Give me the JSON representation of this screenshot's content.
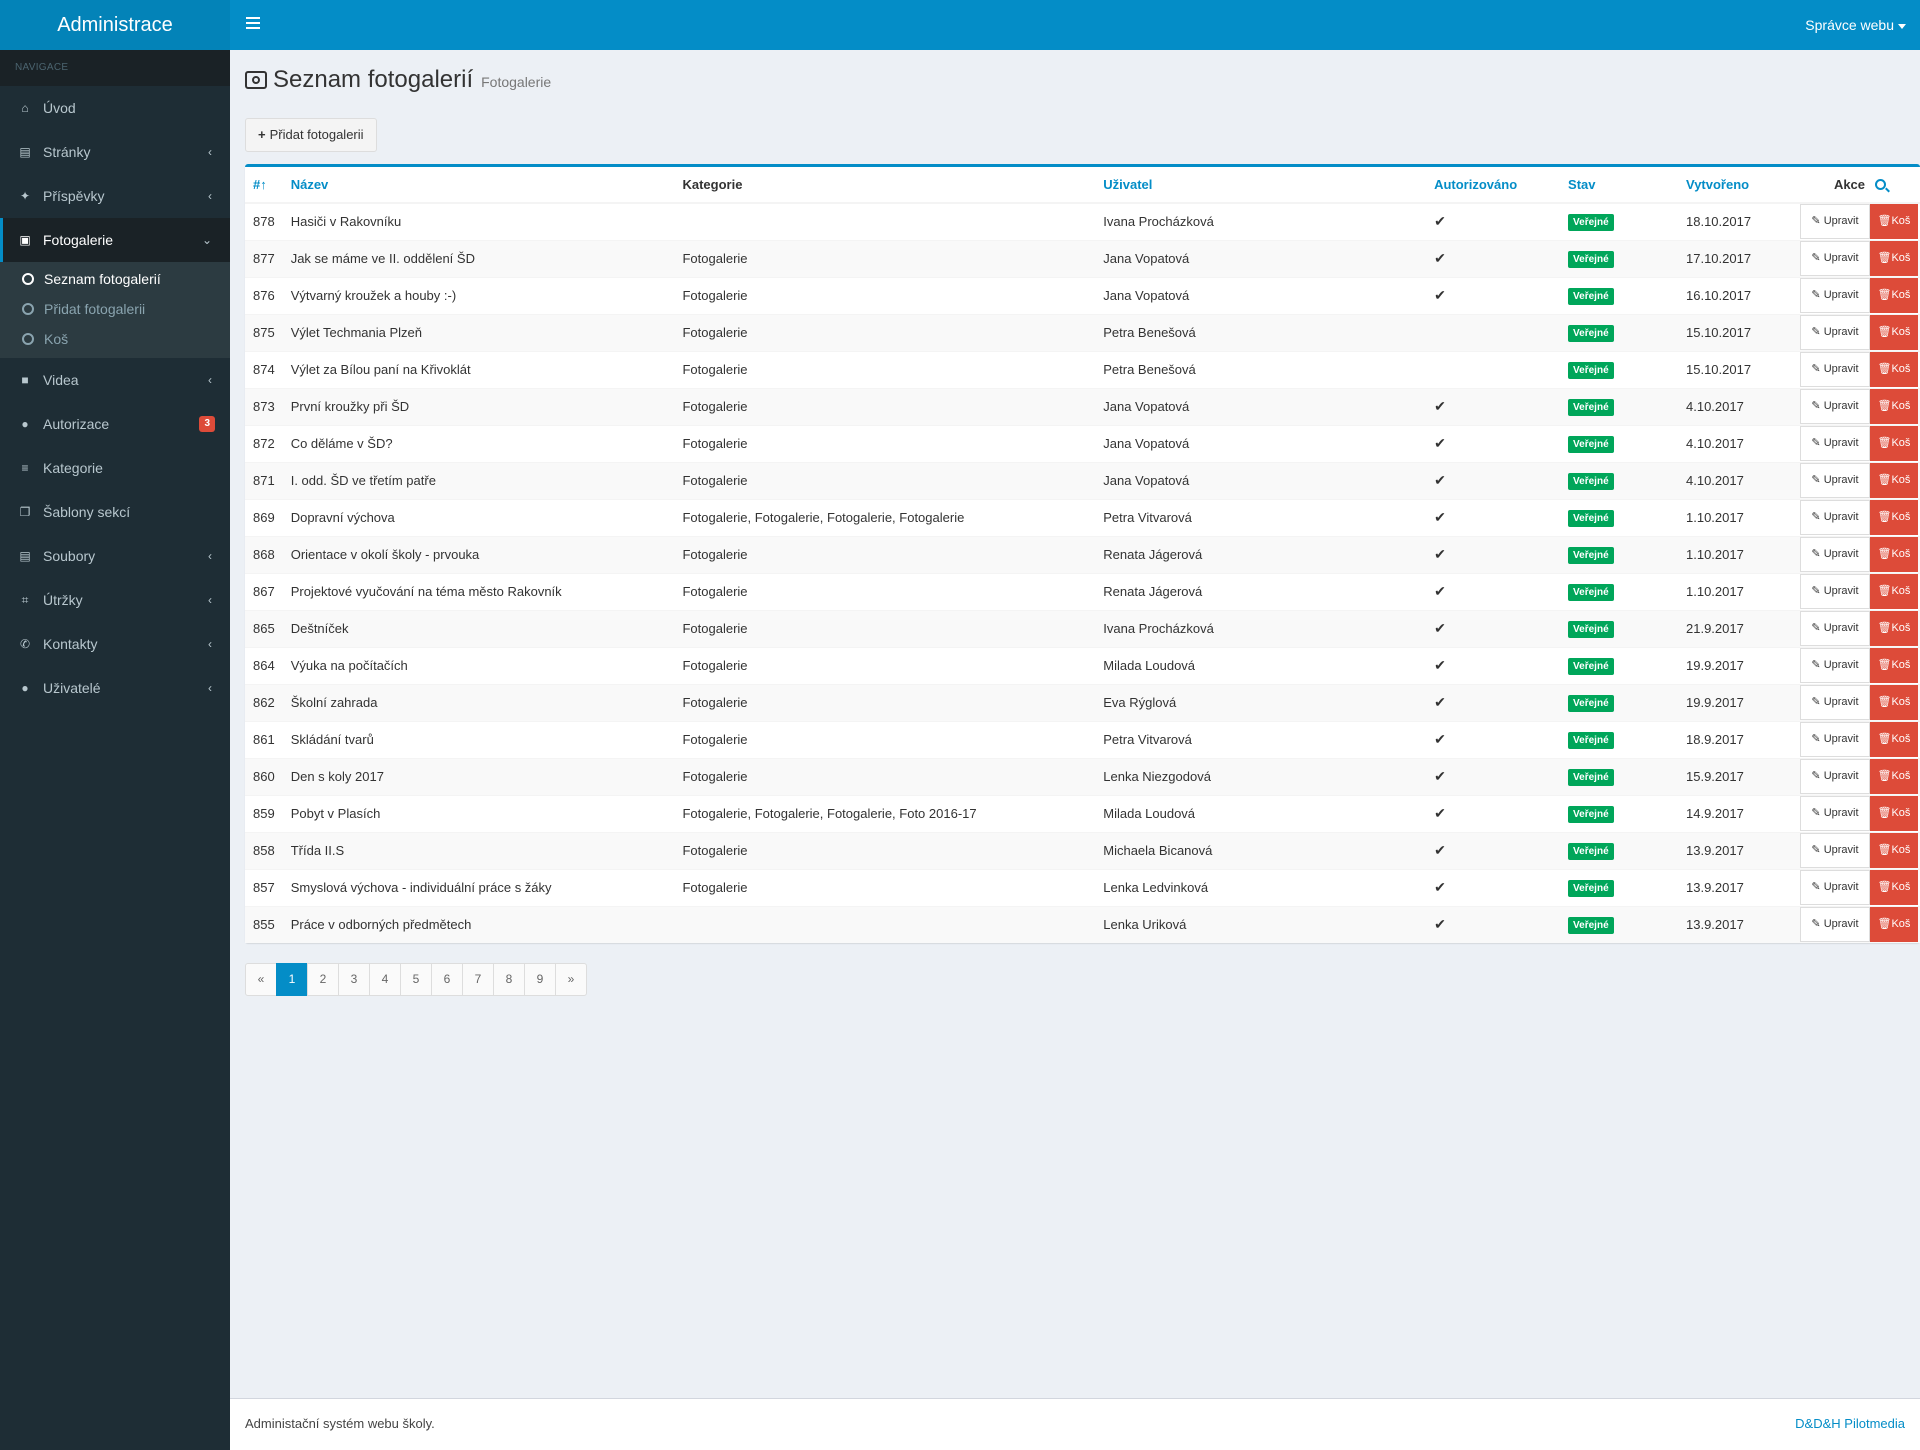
{
  "app": {
    "brand": "Administrace",
    "user_menu": "Správce webu"
  },
  "sidebar": {
    "header": "NAVIGACE",
    "items": [
      {
        "label": "Úvod",
        "icon": "home-icon",
        "chevron": false
      },
      {
        "label": "Stránky",
        "icon": "file-icon",
        "chevron": true
      },
      {
        "label": "Příspěvky",
        "icon": "pin-icon",
        "chevron": true
      },
      {
        "label": "Fotogalerie",
        "icon": "picture-icon",
        "chevron": true,
        "active": true
      },
      {
        "label": "Videa",
        "icon": "video-icon",
        "chevron": true
      },
      {
        "label": "Autorizace",
        "icon": "lock-icon",
        "badge": "3"
      },
      {
        "label": "Kategorie",
        "icon": "list-icon",
        "chevron": false
      },
      {
        "label": "Šablony sekcí",
        "icon": "copy-icon",
        "chevron": false
      },
      {
        "label": "Soubory",
        "icon": "file-icon",
        "chevron": true
      },
      {
        "label": "Útržky",
        "icon": "crop-icon",
        "chevron": true
      },
      {
        "label": "Kontakty",
        "icon": "phone-icon",
        "chevron": true
      },
      {
        "label": "Uživatelé",
        "icon": "user-icon",
        "chevron": true
      }
    ],
    "subitems": [
      {
        "label": "Seznam fotogalerií",
        "current": true
      },
      {
        "label": "Přidat fotogalerii"
      },
      {
        "label": "Koš"
      }
    ]
  },
  "page": {
    "title": "Seznam fotogalerií",
    "subtitle": "Fotogalerie",
    "add_button": "Přidat fotogalerii"
  },
  "table": {
    "columns": [
      "#",
      "Název",
      "Kategorie",
      "Uživatel",
      "Autorizováno",
      "Stav",
      "Vytvořeno",
      "Akce"
    ],
    "edit_label": "Upravit",
    "delete_label": "Koš",
    "rows": [
      {
        "id": "878",
        "name": "Hasiči v Rakovníku",
        "category": "",
        "user": "Ivana Procházková",
        "authorized": true,
        "status": "Veřejné",
        "created": "18.10.2017"
      },
      {
        "id": "877",
        "name": "Jak se máme ve II. oddělení ŠD",
        "category": "Fotogalerie",
        "user": "Jana Vopatová",
        "authorized": true,
        "status": "Veřejné",
        "created": "17.10.2017"
      },
      {
        "id": "876",
        "name": "Výtvarný kroužek a houby :-)",
        "category": "Fotogalerie",
        "user": "Jana Vopatová",
        "authorized": true,
        "status": "Veřejné",
        "created": "16.10.2017"
      },
      {
        "id": "875",
        "name": "Výlet Techmania Plzeň",
        "category": "Fotogalerie",
        "user": "Petra Benešová",
        "authorized": false,
        "status": "Veřejné",
        "created": "15.10.2017"
      },
      {
        "id": "874",
        "name": "Výlet za Bílou paní na Křivoklát",
        "category": "Fotogalerie",
        "user": "Petra Benešová",
        "authorized": false,
        "status": "Veřejné",
        "created": "15.10.2017"
      },
      {
        "id": "873",
        "name": "První kroužky při ŠD",
        "category": "Fotogalerie",
        "user": "Jana Vopatová",
        "authorized": true,
        "status": "Veřejné",
        "created": "4.10.2017"
      },
      {
        "id": "872",
        "name": "Co děláme v ŠD?",
        "category": "Fotogalerie",
        "user": "Jana Vopatová",
        "authorized": true,
        "status": "Veřejné",
        "created": "4.10.2017"
      },
      {
        "id": "871",
        "name": "I. odd. ŠD ve třetím patře",
        "category": "Fotogalerie",
        "user": "Jana Vopatová",
        "authorized": true,
        "status": "Veřejné",
        "created": "4.10.2017"
      },
      {
        "id": "869",
        "name": "Dopravní výchova",
        "category": "Fotogalerie, Fotogalerie, Fotogalerie, Fotogalerie",
        "user": "Petra Vitvarová",
        "authorized": true,
        "status": "Veřejné",
        "created": "1.10.2017"
      },
      {
        "id": "868",
        "name": "Orientace v okolí školy - prvouka",
        "category": "Fotogalerie",
        "user": "Renata Jágerová",
        "authorized": true,
        "status": "Veřejné",
        "created": "1.10.2017"
      },
      {
        "id": "867",
        "name": "Projektové vyučování na téma město Rakovník",
        "category": "Fotogalerie",
        "user": "Renata Jágerová",
        "authorized": true,
        "status": "Veřejné",
        "created": "1.10.2017"
      },
      {
        "id": "865",
        "name": "Deštníček",
        "category": "Fotogalerie",
        "user": "Ivana Procházková",
        "authorized": true,
        "status": "Veřejné",
        "created": "21.9.2017"
      },
      {
        "id": "864",
        "name": "Výuka na počítačích",
        "category": "Fotogalerie",
        "user": "Milada Loudová",
        "authorized": true,
        "status": "Veřejné",
        "created": "19.9.2017"
      },
      {
        "id": "862",
        "name": "Školní zahrada",
        "category": "Fotogalerie",
        "user": "Eva Rýglová",
        "authorized": true,
        "status": "Veřejné",
        "created": "19.9.2017"
      },
      {
        "id": "861",
        "name": "Skládání tvarů",
        "category": "Fotogalerie",
        "user": "Petra Vitvarová",
        "authorized": true,
        "status": "Veřejné",
        "created": "18.9.2017"
      },
      {
        "id": "860",
        "name": "Den s koly 2017",
        "category": "Fotogalerie",
        "user": "Lenka Niezgodová",
        "authorized": true,
        "status": "Veřejné",
        "created": "15.9.2017"
      },
      {
        "id": "859",
        "name": "Pobyt v Plasích",
        "category": "Fotogalerie, Fotogalerie, Fotogalerie, Foto 2016-17",
        "user": "Milada Loudová",
        "authorized": true,
        "status": "Veřejné",
        "created": "14.9.2017"
      },
      {
        "id": "858",
        "name": "Třída II.S",
        "category": "Fotogalerie",
        "user": "Michaela Bicanová",
        "authorized": true,
        "status": "Veřejné",
        "created": "13.9.2017"
      },
      {
        "id": "857",
        "name": "Smyslová výchova - individuální práce s žáky",
        "category": "Fotogalerie",
        "user": "Lenka Ledvinková",
        "authorized": true,
        "status": "Veřejné",
        "created": "13.9.2017"
      },
      {
        "id": "855",
        "name": "Práce v odborných předmětech",
        "category": "",
        "user": "Lenka Uriková",
        "authorized": true,
        "status": "Veřejné",
        "created": "13.9.2017"
      }
    ]
  },
  "pagination": {
    "prev": "«",
    "pages": [
      "1",
      "2",
      "3",
      "4",
      "5",
      "6",
      "7",
      "8",
      "9"
    ],
    "next": "»",
    "current": "1"
  },
  "footer": {
    "left": "Administační systém webu školy.",
    "right": "D&D&H Pilotmedia"
  },
  "colors": {
    "primary": "#048dc7",
    "sidebar": "#1e2d35",
    "success": "#00a65a",
    "danger": "#dd4b39"
  }
}
